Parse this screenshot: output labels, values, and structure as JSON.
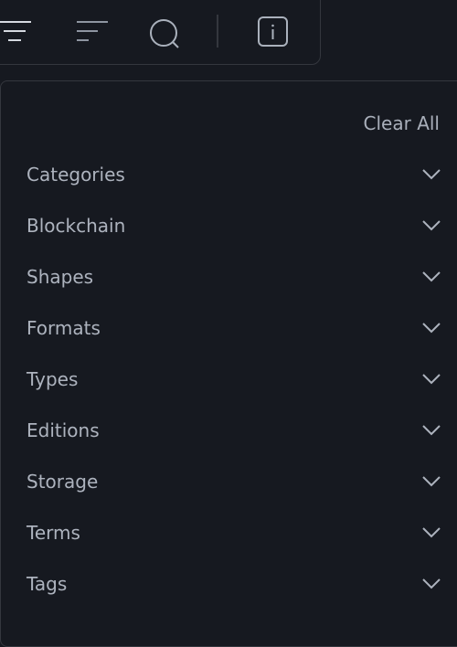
{
  "toolbar": {
    "icons": [
      "filter-icon",
      "sort-icon",
      "search-icon",
      "info-icon"
    ]
  },
  "filters": {
    "clear_all": "Clear All",
    "sections": [
      {
        "label": "Categories"
      },
      {
        "label": "Blockchain"
      },
      {
        "label": "Shapes"
      },
      {
        "label": "Formats"
      },
      {
        "label": "Types"
      },
      {
        "label": "Editions"
      },
      {
        "label": "Storage"
      },
      {
        "label": "Terms"
      },
      {
        "label": "Tags"
      }
    ]
  },
  "colors": {
    "background": "#161920",
    "text": "#adb3be",
    "border": "#34373e"
  }
}
